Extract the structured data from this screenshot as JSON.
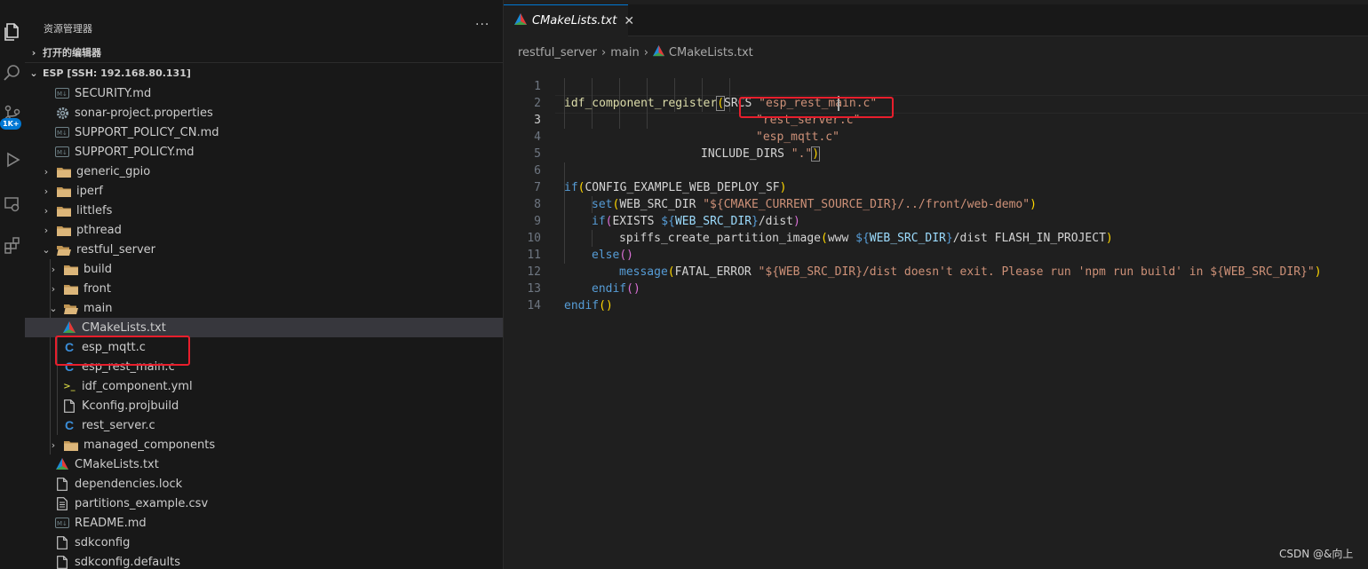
{
  "explorer": {
    "title": "资源管理器",
    "more": "···",
    "open_editors": "打开的编辑器",
    "workspace": "ESP [SSH: 192.168.80.131]",
    "badge": "1K+",
    "items": [
      {
        "label": "SECURITY.md",
        "icon": "markdown-icon"
      },
      {
        "label": "sonar-project.properties",
        "icon": "gear-icon"
      },
      {
        "label": "SUPPORT_POLICY_CN.md",
        "icon": "markdown-icon"
      },
      {
        "label": "SUPPORT_POLICY.md",
        "icon": "markdown-icon"
      },
      {
        "label": "generic_gpio",
        "icon": "folder-icon"
      },
      {
        "label": "iperf",
        "icon": "folder-icon"
      },
      {
        "label": "littlefs",
        "icon": "folder-icon"
      },
      {
        "label": "pthread",
        "icon": "folder-icon"
      },
      {
        "label": "restful_server",
        "icon": "folder-open-icon"
      },
      {
        "label": "build",
        "icon": "folder-icon"
      },
      {
        "label": "front",
        "icon": "folder-icon"
      },
      {
        "label": "main",
        "icon": "folder-open-icon"
      },
      {
        "label": "CMakeLists.txt",
        "icon": "cmake-icon"
      },
      {
        "label": "esp_mqtt.c",
        "icon": "c-file-icon"
      },
      {
        "label": "esp_rest_main.c",
        "icon": "c-file-icon"
      },
      {
        "label": "idf_component.yml",
        "icon": "yaml-icon"
      },
      {
        "label": "Kconfig.projbuild",
        "icon": "file-icon"
      },
      {
        "label": "rest_server.c",
        "icon": "c-file-icon"
      },
      {
        "label": "managed_components",
        "icon": "folder-icon"
      },
      {
        "label": "CMakeLists.txt",
        "icon": "cmake-icon"
      },
      {
        "label": "dependencies.lock",
        "icon": "file-icon"
      },
      {
        "label": "partitions_example.csv",
        "icon": "csv-icon"
      },
      {
        "label": "README.md",
        "icon": "markdown-icon"
      },
      {
        "label": "sdkconfig",
        "icon": "file-icon"
      },
      {
        "label": "sdkconfig.defaults",
        "icon": "file-icon"
      }
    ]
  },
  "editor": {
    "tab_label": "CMakeLists.txt",
    "tab_close": "✕",
    "breadcrumb": [
      "restful_server",
      "main",
      "CMakeLists.txt"
    ],
    "line_numbers": [
      "1",
      "2",
      "3",
      "4",
      "5",
      "6",
      "7",
      "8",
      "9",
      "10",
      "11",
      "12",
      "13",
      "14"
    ],
    "current_line": "3"
  },
  "code": {
    "l1_fn": "idf_component_register",
    "l1_open": "(",
    "l1_kw": "SRCS ",
    "l1_str": "\"esp_rest_main.c\"",
    "l2_str": "\"rest_server.c\"",
    "l3_str": "\"esp_mqtt.c\"",
    "l4_kw": "INCLUDE_DIRS ",
    "l4_str": "\".\"",
    "l4_close": ")",
    "l6_if": "if",
    "l6_open": "(",
    "l6_var": "CONFIG_EXAMPLE_WEB_DEPLOY_SF",
    "l6_close": ")",
    "l7_set": "set",
    "l7_open": "(",
    "l7_arg": "WEB_SRC_DIR ",
    "l7_str": "\"${CMAKE_CURRENT_SOURCE_DIR}/../front/web-demo\"",
    "l7_close": ")",
    "l8_if": "if",
    "l8_open": "(",
    "l8_kw": "EXISTS ",
    "l8_dollar": "${",
    "l8_var": "WEB_SRC_DIR",
    "l8_end": "}",
    "l8_rest": "/dist",
    "l8_close": ")",
    "l9_fn": "spiffs_create_partition_image",
    "l9_open": "(",
    "l9_a": "www ",
    "l9_dollar": "${",
    "l9_var": "WEB_SRC_DIR",
    "l9_end": "}",
    "l9_rest": "/dist FLASH_IN_PROJECT",
    "l9_close": ")",
    "l10_else": "else",
    "l10_paren": "()",
    "l11_fn": "message",
    "l11_open": "(",
    "l11_kw": "FATAL_ERROR ",
    "l11_str1": "\"${WEB_SRC_DIR}/dist doesn't exit. Please run 'npm run build' in ${WEB_SRC_DIR}\"",
    "l11_close": ")",
    "l12_endif": "endif",
    "l12_paren": "()",
    "l13_endif": "endif",
    "l13_paren": "()"
  },
  "watermark": "CSDN @&向上",
  "colors": {
    "accent": "#0078d4",
    "highlight_box": "#e81e2c",
    "selection": "#37373d"
  }
}
